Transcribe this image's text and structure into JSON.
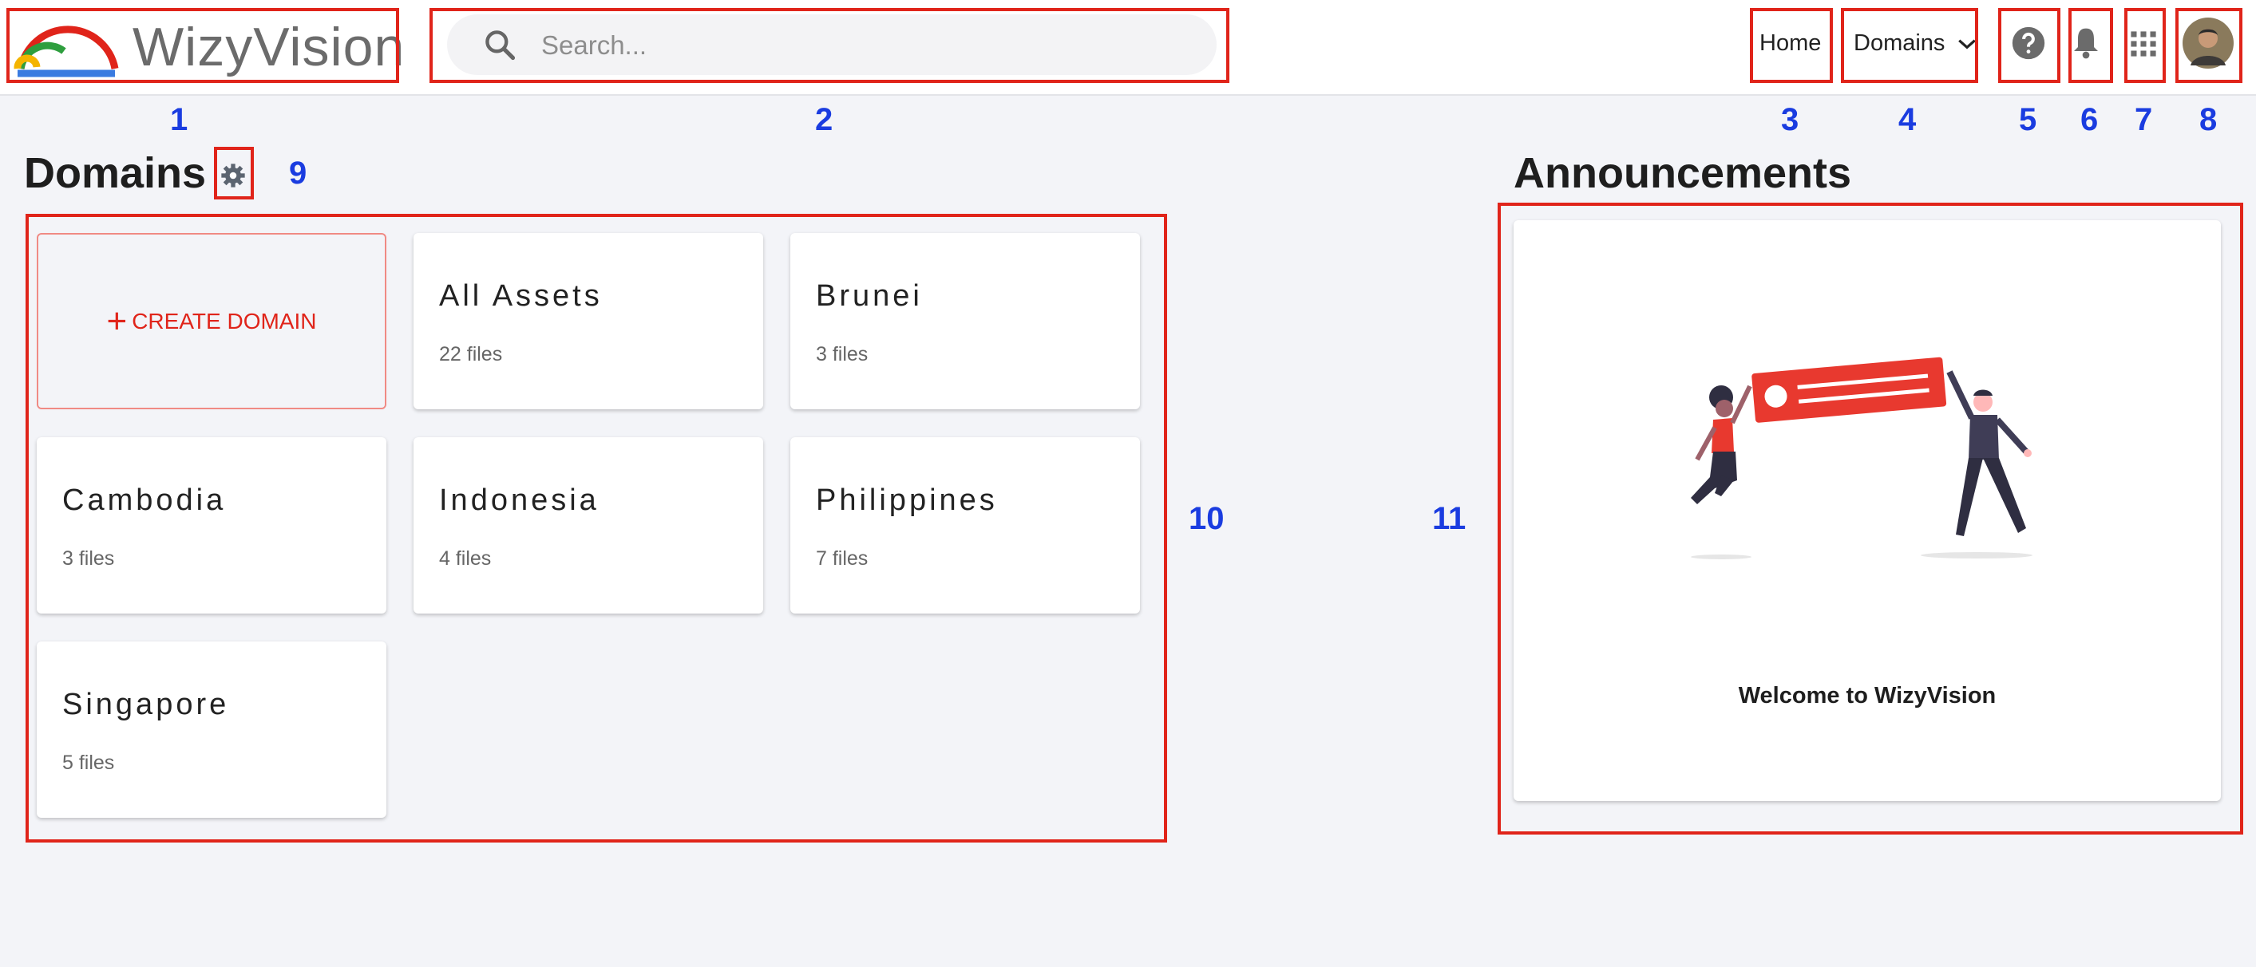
{
  "header": {
    "logo_text": "WizyVision",
    "search_placeholder": "Search...",
    "nav": {
      "home_label": "Home",
      "domains_label": "Domains"
    },
    "icons": [
      "search-icon",
      "help-icon",
      "bell-icon",
      "apps-grid-icon",
      "user-avatar"
    ]
  },
  "domains": {
    "heading": "Domains",
    "create_label": "CREATE DOMAIN",
    "cards": [
      {
        "name": "All Assets",
        "files": "22 files"
      },
      {
        "name": "Brunei",
        "files": "3 files"
      },
      {
        "name": "Cambodia",
        "files": "3 files"
      },
      {
        "name": "Indonesia",
        "files": "4 files"
      },
      {
        "name": "Philippines",
        "files": "7 files"
      },
      {
        "name": "Singapore",
        "files": "5 files"
      }
    ]
  },
  "announcements": {
    "heading": "Announcements",
    "caption": "Welcome to WizyVision"
  },
  "annotations": [
    "1",
    "2",
    "3",
    "4",
    "5",
    "6",
    "7",
    "8",
    "9",
    "10",
    "11"
  ],
  "colors": {
    "accent": "#e0241a",
    "annotation": "#1a3ce0",
    "background": "#f3f4f8"
  }
}
